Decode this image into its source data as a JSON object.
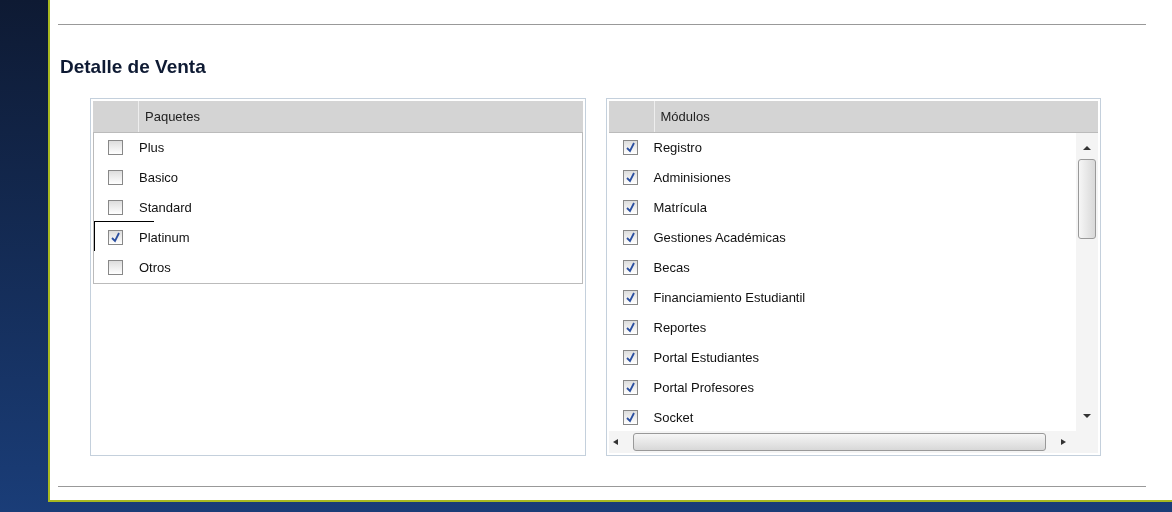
{
  "title": "Detalle de Venta",
  "grids": [
    {
      "header": "Paquetes",
      "scrollable": false,
      "rows": [
        {
          "label": "Plus",
          "checked": false,
          "focused": false
        },
        {
          "label": "Basico",
          "checked": false,
          "focused": false
        },
        {
          "label": "Standard",
          "checked": false,
          "focused": false
        },
        {
          "label": "Platinum",
          "checked": true,
          "focused": true
        },
        {
          "label": "Otros",
          "checked": false,
          "focused": false
        }
      ]
    },
    {
      "header": "Módulos",
      "scrollable": true,
      "rows": [
        {
          "label": "Registro",
          "checked": true,
          "focused": false
        },
        {
          "label": "Adminisiones",
          "checked": true,
          "focused": false
        },
        {
          "label": "Matrícula",
          "checked": true,
          "focused": false
        },
        {
          "label": "Gestiones Académicas",
          "checked": true,
          "focused": false
        },
        {
          "label": "Becas",
          "checked": true,
          "focused": false
        },
        {
          "label": "Financiamiento Estudiantil",
          "checked": true,
          "focused": false
        },
        {
          "label": "Reportes",
          "checked": true,
          "focused": false
        },
        {
          "label": "Portal Estudiantes",
          "checked": true,
          "focused": false
        },
        {
          "label": "Portal Profesores",
          "checked": true,
          "focused": false
        },
        {
          "label": "Socket",
          "checked": true,
          "focused": false
        }
      ]
    }
  ]
}
